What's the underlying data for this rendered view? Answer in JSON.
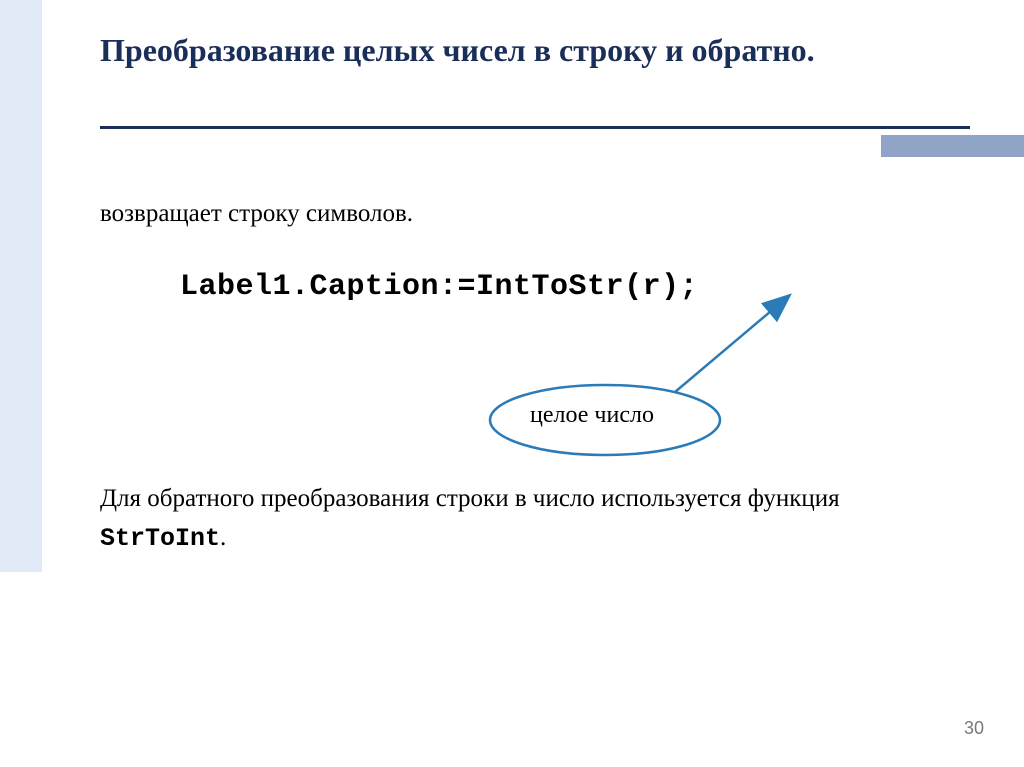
{
  "title": "Преобразование целых чисел в строку и обратно.",
  "intro": "возвращает строку символов.",
  "code_line": "Label1.Caption:=IntToStr(r);",
  "callout_label": "целое число",
  "para2_part1": "Для обратного преобразования строки в число используется функция ",
  "para2_code": "StrToInt",
  "para2_part2": ".",
  "page_number": "30",
  "colors": {
    "title": "#1a2e5a",
    "arrow": "#2b7bb9",
    "left_bar": "#dfeaf6",
    "accent_box": "#8fa4c7"
  }
}
